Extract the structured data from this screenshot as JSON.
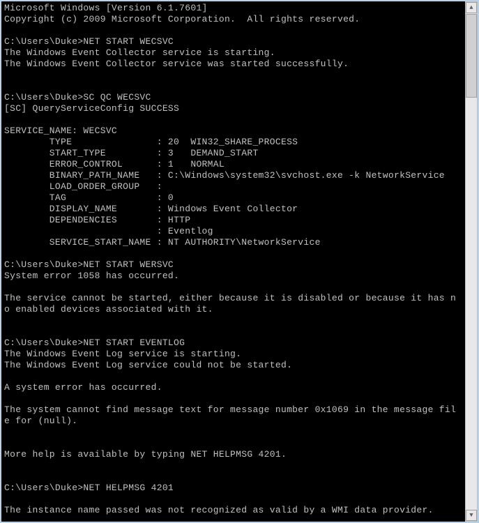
{
  "terminal": {
    "lines": [
      "Microsoft Windows [Version 6.1.7601]",
      "Copyright (c) 2009 Microsoft Corporation.  All rights reserved.",
      "",
      "C:\\Users\\Duke>NET START WECSVC",
      "The Windows Event Collector service is starting.",
      "The Windows Event Collector service was started successfully.",
      "",
      "",
      "C:\\Users\\Duke>SC QC WECSVC",
      "[SC] QueryServiceConfig SUCCESS",
      "",
      "SERVICE_NAME: WECSVC",
      "        TYPE               : 20  WIN32_SHARE_PROCESS",
      "        START_TYPE         : 3   DEMAND_START",
      "        ERROR_CONTROL      : 1   NORMAL",
      "        BINARY_PATH_NAME   : C:\\Windows\\system32\\svchost.exe -k NetworkService",
      "        LOAD_ORDER_GROUP   :",
      "        TAG                : 0",
      "        DISPLAY_NAME       : Windows Event Collector",
      "        DEPENDENCIES       : HTTP",
      "                           : Eventlog",
      "        SERVICE_START_NAME : NT AUTHORITY\\NetworkService",
      "",
      "C:\\Users\\Duke>NET START WERSVC",
      "System error 1058 has occurred.",
      "",
      "The service cannot be started, either because it is disabled or because it has n",
      "o enabled devices associated with it.",
      "",
      "",
      "C:\\Users\\Duke>NET START EVENTLOG",
      "The Windows Event Log service is starting.",
      "The Windows Event Log service could not be started.",
      "",
      "A system error has occurred.",
      "",
      "The system cannot find message text for message number 0x1069 in the message fil",
      "e for (null).",
      "",
      "",
      "More help is available by typing NET HELPMSG 4201.",
      "",
      "",
      "C:\\Users\\Duke>NET HELPMSG 4201",
      "",
      "The instance name passed was not recognized as valid by a WMI data provider."
    ]
  },
  "scrollbar": {
    "up_arrow": "▲",
    "down_arrow": "▼"
  }
}
